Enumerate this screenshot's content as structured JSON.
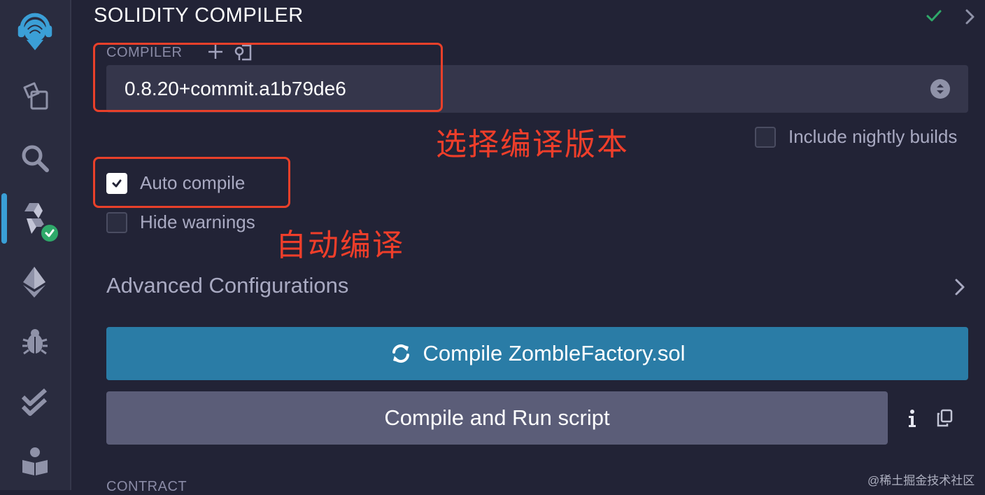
{
  "panel": {
    "title": "SOLIDITY COMPILER"
  },
  "compiler": {
    "label": "COMPILER",
    "selected_version": "0.8.20+commit.a1b79de6"
  },
  "checkboxes": {
    "include_nightly": {
      "label": "Include nightly builds",
      "checked": false
    },
    "auto_compile": {
      "label": "Auto compile",
      "checked": true
    },
    "hide_warnings": {
      "label": "Hide warnings",
      "checked": false
    }
  },
  "advanced": {
    "label": "Advanced Configurations"
  },
  "buttons": {
    "compile": "Compile ZombleFactory.sol",
    "compile_run": "Compile and Run script"
  },
  "contract": {
    "label": "CONTRACT"
  },
  "annotations": {
    "select_version": "选择编译版本",
    "auto_compile": "自动编译"
  },
  "watermark": "@稀土掘金技术社区",
  "icons": {
    "sidebar": [
      "remix-logo-icon",
      "file-explorer-icon",
      "search-icon",
      "solidity-compiler-icon",
      "deploy-run-icon",
      "debugger-icon",
      "unit-test-icon",
      "learneth-icon"
    ],
    "header": [
      "check-icon",
      "chevron-right-icon"
    ]
  },
  "colors": {
    "background": "#222336",
    "sidebar": "#2a2c3f",
    "compile_button": "#2a7ca6",
    "run_button": "#5b5d78",
    "annotation": "#e9402a",
    "success": "#2fa96a"
  }
}
